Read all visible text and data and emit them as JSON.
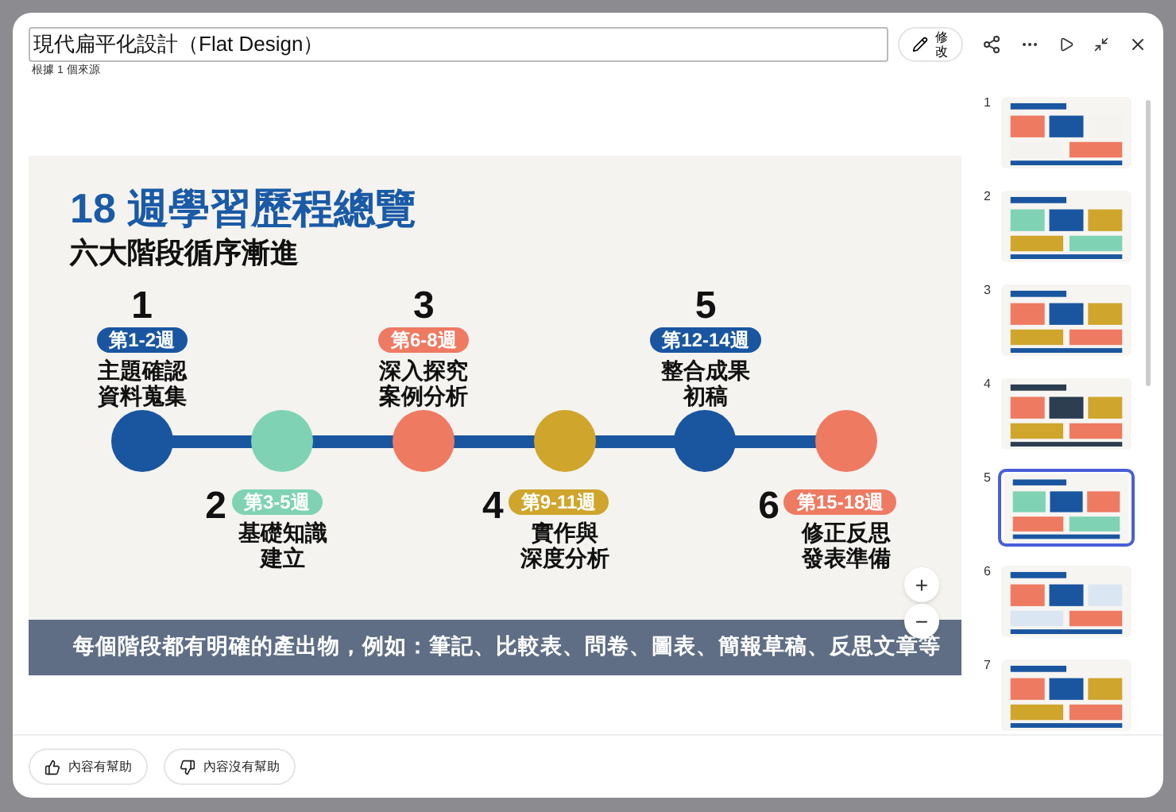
{
  "title_field": {
    "value": "現代扁平化設計（Flat Design）"
  },
  "source_note": "根據 1 個來源",
  "edit_button": "修改",
  "slide": {
    "title": "18 週學習歷程總覽",
    "subtitle": "六大階段循序漸進",
    "stages": [
      {
        "number": "1",
        "weeks": "第1-2週",
        "lines": [
          "主題確認",
          "資料蒐集"
        ],
        "color": "#1a56a0",
        "kind": "above"
      },
      {
        "number": "2",
        "weeks": "第3-5週",
        "lines": [
          "基礎知識",
          "建立"
        ],
        "color": "#7fd3b4",
        "kind": "below"
      },
      {
        "number": "3",
        "weeks": "第6-8週",
        "lines": [
          "深入探究",
          "案例分析"
        ],
        "color": "#ee7a62",
        "kind": "above"
      },
      {
        "number": "4",
        "weeks": "第9-11週",
        "lines": [
          "實作與",
          "深度分析"
        ],
        "color": "#cfa52c",
        "kind": "below"
      },
      {
        "number": "5",
        "weeks": "第12-14週",
        "lines": [
          "整合成果",
          "初稿"
        ],
        "color": "#1a56a0",
        "kind": "above"
      },
      {
        "number": "6",
        "weeks": "第15-18週",
        "lines": [
          "修正反思",
          "發表準備"
        ],
        "color": "#ee7a62",
        "kind": "below"
      }
    ],
    "footer": "每個階段都有明確的產出物，例如：筆記、比較表、問卷、圖表、簡報草稿、反思文章等"
  },
  "zoom_buttons": [
    "+",
    "−"
  ],
  "thumbnails": [
    {
      "number": "1",
      "selected": false
    },
    {
      "number": "2",
      "selected": false
    },
    {
      "number": "3",
      "selected": false
    },
    {
      "number": "4",
      "selected": false
    },
    {
      "number": "5",
      "selected": true
    },
    {
      "number": "6",
      "selected": false
    },
    {
      "number": "7",
      "selected": false
    }
  ],
  "feedback_buttons": [
    {
      "label": "內容有幫助",
      "kind": "up"
    },
    {
      "label": "內容沒有幫助",
      "kind": "down"
    }
  ]
}
